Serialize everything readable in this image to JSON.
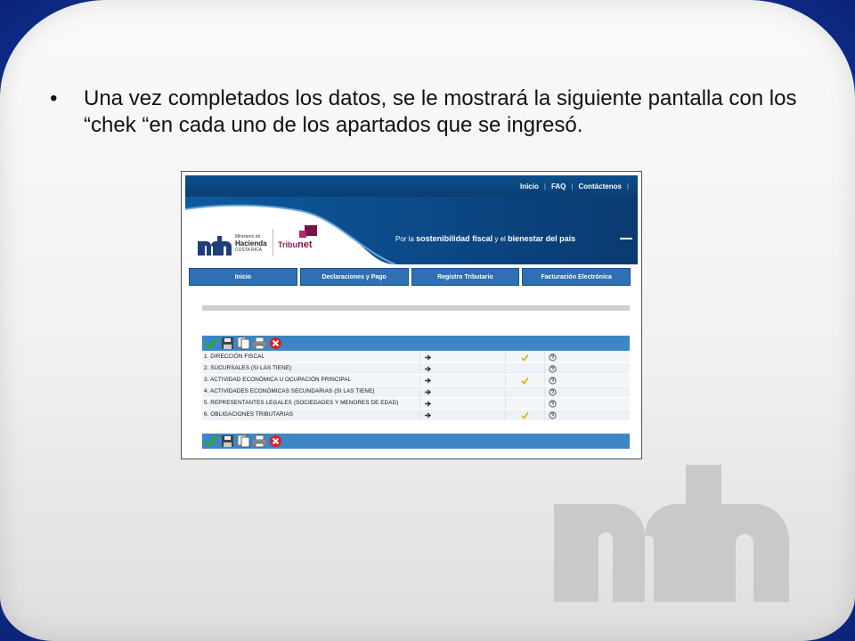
{
  "slide": {
    "bullet": "•",
    "text": "Una vez completados los datos, se le mostrará la siguiente  pantalla con los “chek “en cada uno de los apartados que se ingresó."
  },
  "screenshot": {
    "top_links": [
      "Inicio",
      "FAQ",
      "Contáctenos"
    ],
    "ministry": {
      "line1": "Ministerio de",
      "line2": "Hacienda",
      "line3": "COSTA RICA"
    },
    "brand": {
      "tribu": "Tribu",
      "net": "net"
    },
    "slogan": {
      "pre": "Por la ",
      "strong1": "sostenibilidad fiscal",
      "mid": " y el ",
      "strong2": "bienestar del país"
    },
    "nav": [
      "Inicio",
      "Declaraciones y Pago",
      "Registro Tributario",
      "Facturación Electrónica"
    ],
    "rows": [
      {
        "label": "1. DIRECCIÓN FISCAL",
        "checked": true
      },
      {
        "label": "2. SUCURSALES (SI LAS TIENE)",
        "checked": false
      },
      {
        "label": "3. ACTIVIDAD ECONÓMICA U OCUPACIÓN PRINCIPAL",
        "checked": true
      },
      {
        "label": "4. ACTIVIDADES ECONÓMICAS SECUNDARIAS (SI LAS TIENE)",
        "checked": false
      },
      {
        "label": "5. REPRESENTANTES LEGALES (SOCIEDADES Y MENORES DE EDAD)",
        "checked": false
      },
      {
        "label": "6. OBLIGACIONES TRIBUTARIAS",
        "checked": true
      }
    ],
    "toolbar_icons": [
      "check-icon",
      "save-icon",
      "copy-icon",
      "print-icon",
      "cancel-icon"
    ]
  },
  "colors": {
    "frame_blue": "#13379e",
    "header_blue": "#0a3f74",
    "nav_blue": "#2f6fb4",
    "toolbar_blue": "#3d86c6",
    "brand_magenta": "#7a1248"
  }
}
